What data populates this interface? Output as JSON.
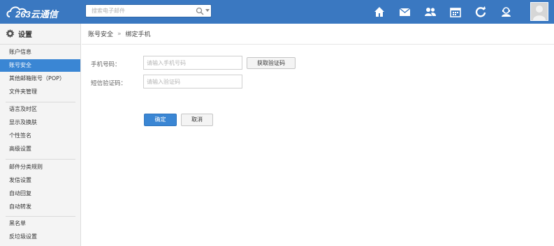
{
  "brand": {
    "logo_text": "263云通信"
  },
  "search": {
    "placeholder": "搜索电子邮件"
  },
  "topbar": {
    "icons": [
      "home-icon",
      "mail-icon",
      "contacts-icon",
      "calendar-icon",
      "sync-icon",
      "user-support-icon"
    ],
    "accent": "#3a78c1"
  },
  "sidebar": {
    "title": "设置",
    "items": [
      {
        "label": "账户信息"
      },
      {
        "label": "账号安全",
        "active": true
      },
      {
        "label": "其他邮箱账号（POP）"
      },
      {
        "label": "文件夹管理"
      },
      {
        "label": "语言及时区"
      },
      {
        "label": "显示及换肤"
      },
      {
        "label": "个性签名"
      },
      {
        "label": "高级设置"
      },
      {
        "label": "邮件分类规则"
      },
      {
        "label": "发信设置"
      },
      {
        "label": "自动回复"
      },
      {
        "label": "自动转发"
      },
      {
        "label": "黑名单"
      },
      {
        "label": "反垃圾设置"
      }
    ]
  },
  "breadcrumb": {
    "parent": "账号安全",
    "separator": "»",
    "current": "绑定手机"
  },
  "form": {
    "phone_label": "手机号码：",
    "phone_placeholder": "请输入手机号码",
    "get_code_label": "获取验证码",
    "sms_label": "短信验证码：",
    "sms_placeholder": "请输入验证码",
    "ok_label": "确定",
    "cancel_label": "取消"
  },
  "colors": {
    "active_nav": "#3a86d4",
    "primary_button": "#3a86d4"
  }
}
